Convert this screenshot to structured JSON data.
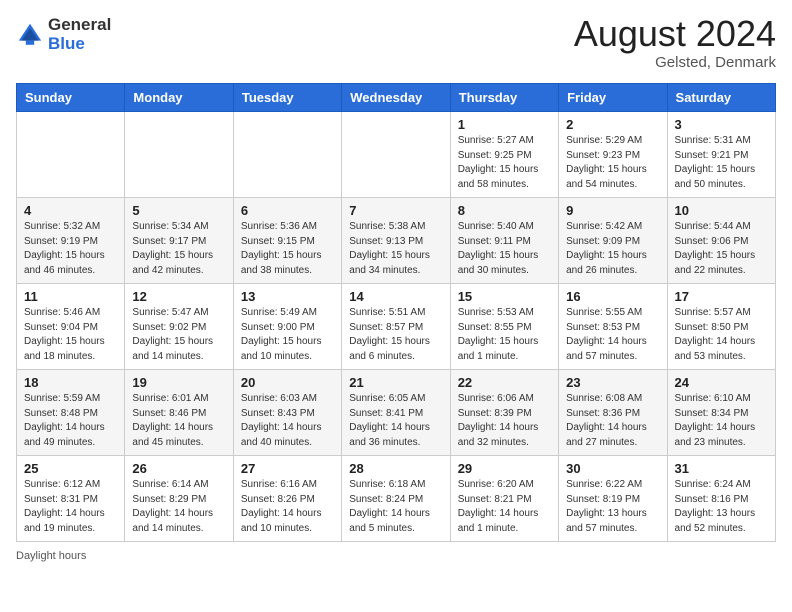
{
  "header": {
    "logo_general": "General",
    "logo_blue": "Blue",
    "month_year": "August 2024",
    "location": "Gelsted, Denmark"
  },
  "days_of_week": [
    "Sunday",
    "Monday",
    "Tuesday",
    "Wednesday",
    "Thursday",
    "Friday",
    "Saturday"
  ],
  "weeks": [
    [
      {
        "day": "",
        "info": ""
      },
      {
        "day": "",
        "info": ""
      },
      {
        "day": "",
        "info": ""
      },
      {
        "day": "",
        "info": ""
      },
      {
        "day": "1",
        "info": "Sunrise: 5:27 AM\nSunset: 9:25 PM\nDaylight: 15 hours\nand 58 minutes."
      },
      {
        "day": "2",
        "info": "Sunrise: 5:29 AM\nSunset: 9:23 PM\nDaylight: 15 hours\nand 54 minutes."
      },
      {
        "day": "3",
        "info": "Sunrise: 5:31 AM\nSunset: 9:21 PM\nDaylight: 15 hours\nand 50 minutes."
      }
    ],
    [
      {
        "day": "4",
        "info": "Sunrise: 5:32 AM\nSunset: 9:19 PM\nDaylight: 15 hours\nand 46 minutes."
      },
      {
        "day": "5",
        "info": "Sunrise: 5:34 AM\nSunset: 9:17 PM\nDaylight: 15 hours\nand 42 minutes."
      },
      {
        "day": "6",
        "info": "Sunrise: 5:36 AM\nSunset: 9:15 PM\nDaylight: 15 hours\nand 38 minutes."
      },
      {
        "day": "7",
        "info": "Sunrise: 5:38 AM\nSunset: 9:13 PM\nDaylight: 15 hours\nand 34 minutes."
      },
      {
        "day": "8",
        "info": "Sunrise: 5:40 AM\nSunset: 9:11 PM\nDaylight: 15 hours\nand 30 minutes."
      },
      {
        "day": "9",
        "info": "Sunrise: 5:42 AM\nSunset: 9:09 PM\nDaylight: 15 hours\nand 26 minutes."
      },
      {
        "day": "10",
        "info": "Sunrise: 5:44 AM\nSunset: 9:06 PM\nDaylight: 15 hours\nand 22 minutes."
      }
    ],
    [
      {
        "day": "11",
        "info": "Sunrise: 5:46 AM\nSunset: 9:04 PM\nDaylight: 15 hours\nand 18 minutes."
      },
      {
        "day": "12",
        "info": "Sunrise: 5:47 AM\nSunset: 9:02 PM\nDaylight: 15 hours\nand 14 minutes."
      },
      {
        "day": "13",
        "info": "Sunrise: 5:49 AM\nSunset: 9:00 PM\nDaylight: 15 hours\nand 10 minutes."
      },
      {
        "day": "14",
        "info": "Sunrise: 5:51 AM\nSunset: 8:57 PM\nDaylight: 15 hours\nand 6 minutes."
      },
      {
        "day": "15",
        "info": "Sunrise: 5:53 AM\nSunset: 8:55 PM\nDaylight: 15 hours\nand 1 minute."
      },
      {
        "day": "16",
        "info": "Sunrise: 5:55 AM\nSunset: 8:53 PM\nDaylight: 14 hours\nand 57 minutes."
      },
      {
        "day": "17",
        "info": "Sunrise: 5:57 AM\nSunset: 8:50 PM\nDaylight: 14 hours\nand 53 minutes."
      }
    ],
    [
      {
        "day": "18",
        "info": "Sunrise: 5:59 AM\nSunset: 8:48 PM\nDaylight: 14 hours\nand 49 minutes."
      },
      {
        "day": "19",
        "info": "Sunrise: 6:01 AM\nSunset: 8:46 PM\nDaylight: 14 hours\nand 45 minutes."
      },
      {
        "day": "20",
        "info": "Sunrise: 6:03 AM\nSunset: 8:43 PM\nDaylight: 14 hours\nand 40 minutes."
      },
      {
        "day": "21",
        "info": "Sunrise: 6:05 AM\nSunset: 8:41 PM\nDaylight: 14 hours\nand 36 minutes."
      },
      {
        "day": "22",
        "info": "Sunrise: 6:06 AM\nSunset: 8:39 PM\nDaylight: 14 hours\nand 32 minutes."
      },
      {
        "day": "23",
        "info": "Sunrise: 6:08 AM\nSunset: 8:36 PM\nDaylight: 14 hours\nand 27 minutes."
      },
      {
        "day": "24",
        "info": "Sunrise: 6:10 AM\nSunset: 8:34 PM\nDaylight: 14 hours\nand 23 minutes."
      }
    ],
    [
      {
        "day": "25",
        "info": "Sunrise: 6:12 AM\nSunset: 8:31 PM\nDaylight: 14 hours\nand 19 minutes."
      },
      {
        "day": "26",
        "info": "Sunrise: 6:14 AM\nSunset: 8:29 PM\nDaylight: 14 hours\nand 14 minutes."
      },
      {
        "day": "27",
        "info": "Sunrise: 6:16 AM\nSunset: 8:26 PM\nDaylight: 14 hours\nand 10 minutes."
      },
      {
        "day": "28",
        "info": "Sunrise: 6:18 AM\nSunset: 8:24 PM\nDaylight: 14 hours\nand 5 minutes."
      },
      {
        "day": "29",
        "info": "Sunrise: 6:20 AM\nSunset: 8:21 PM\nDaylight: 14 hours\nand 1 minute."
      },
      {
        "day": "30",
        "info": "Sunrise: 6:22 AM\nSunset: 8:19 PM\nDaylight: 13 hours\nand 57 minutes."
      },
      {
        "day": "31",
        "info": "Sunrise: 6:24 AM\nSunset: 8:16 PM\nDaylight: 13 hours\nand 52 minutes."
      }
    ]
  ],
  "footer": {
    "daylight_hours_label": "Daylight hours"
  }
}
